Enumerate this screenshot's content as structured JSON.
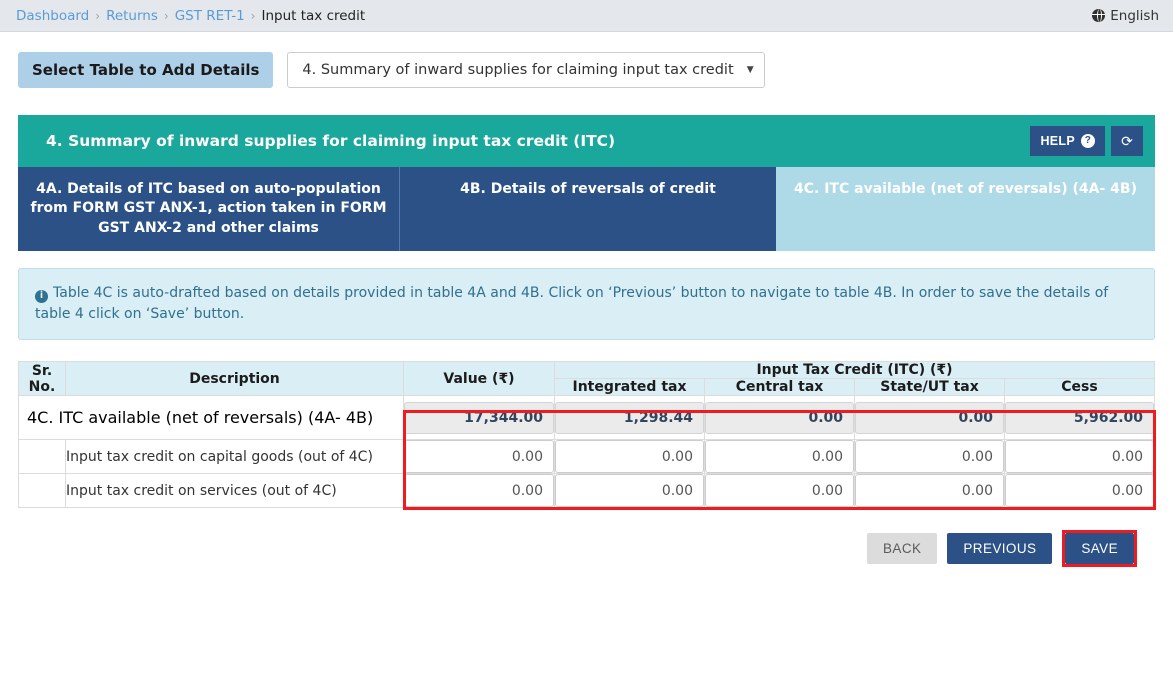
{
  "breadcrumb": {
    "items": [
      "Dashboard",
      "Returns",
      "GST RET-1",
      "Input tax credit"
    ],
    "separator": "›"
  },
  "header": {
    "language": "English",
    "globe_icon": "globe-icon"
  },
  "select_table": {
    "label": "Select Table to Add Details",
    "selected_option": "4. Summary of inward supplies for claiming input tax credit",
    "caret": "▼"
  },
  "panel": {
    "title": "4. Summary of inward supplies for claiming input tax credit (ITC)",
    "help_label": "HELP",
    "help_icon_glyph": "?",
    "refresh_icon_glyph": "⟳",
    "accent_teal": "#1aa79c",
    "accent_navy": "#2b5186",
    "accent_lightblue": "#aed9e6"
  },
  "tabs": [
    {
      "id": "4A",
      "label": "4A. Details of ITC based on auto-population from FORM GST ANX-1, action taken in FORM GST ANX-2 and other claims",
      "active": false
    },
    {
      "id": "4B",
      "label": "4B. Details of reversals of credit",
      "active": false
    },
    {
      "id": "4C",
      "label": "4C. ITC available (net of reversals) (4A- 4B)",
      "active": true
    }
  ],
  "note": {
    "icon": "info-icon",
    "text": "Table 4C is auto-drafted based on details provided in table 4A and 4B. Click on ‘Previous’ button to navigate to table 4B. In order to save the details of table 4 click on ‘Save’ button."
  },
  "table": {
    "headers": {
      "sr_no": "Sr. No.",
      "description": "Description",
      "value": "Value (₹)",
      "itc_group": "Input Tax Credit (ITC) (₹)",
      "integrated_tax": "Integrated tax",
      "central_tax": "Central tax",
      "state_ut_tax": "State/UT tax",
      "cess": "Cess"
    },
    "rows": [
      {
        "sr_no": "",
        "description": "4C. ITC available (net of reversals) (4A- 4B)",
        "bold": true,
        "readonly": true,
        "value": "17,344.00",
        "integrated_tax": "1,298.44",
        "central_tax": "0.00",
        "state_ut_tax": "0.00",
        "cess": "5,962.00"
      },
      {
        "sr_no": "",
        "description": "Input tax credit on capital goods (out of 4C)",
        "bold": false,
        "readonly": false,
        "value": "0.00",
        "integrated_tax": "0.00",
        "central_tax": "0.00",
        "state_ut_tax": "0.00",
        "cess": "0.00"
      },
      {
        "sr_no": "",
        "description": "Input tax credit on services (out of 4C)",
        "bold": false,
        "readonly": false,
        "value": "0.00",
        "integrated_tax": "0.00",
        "central_tax": "0.00",
        "state_ut_tax": "0.00",
        "cess": "0.00"
      }
    ]
  },
  "footer": {
    "back": "BACK",
    "previous": "PREVIOUS",
    "save": "SAVE"
  },
  "highlights": {
    "color": "#ee1c21"
  }
}
